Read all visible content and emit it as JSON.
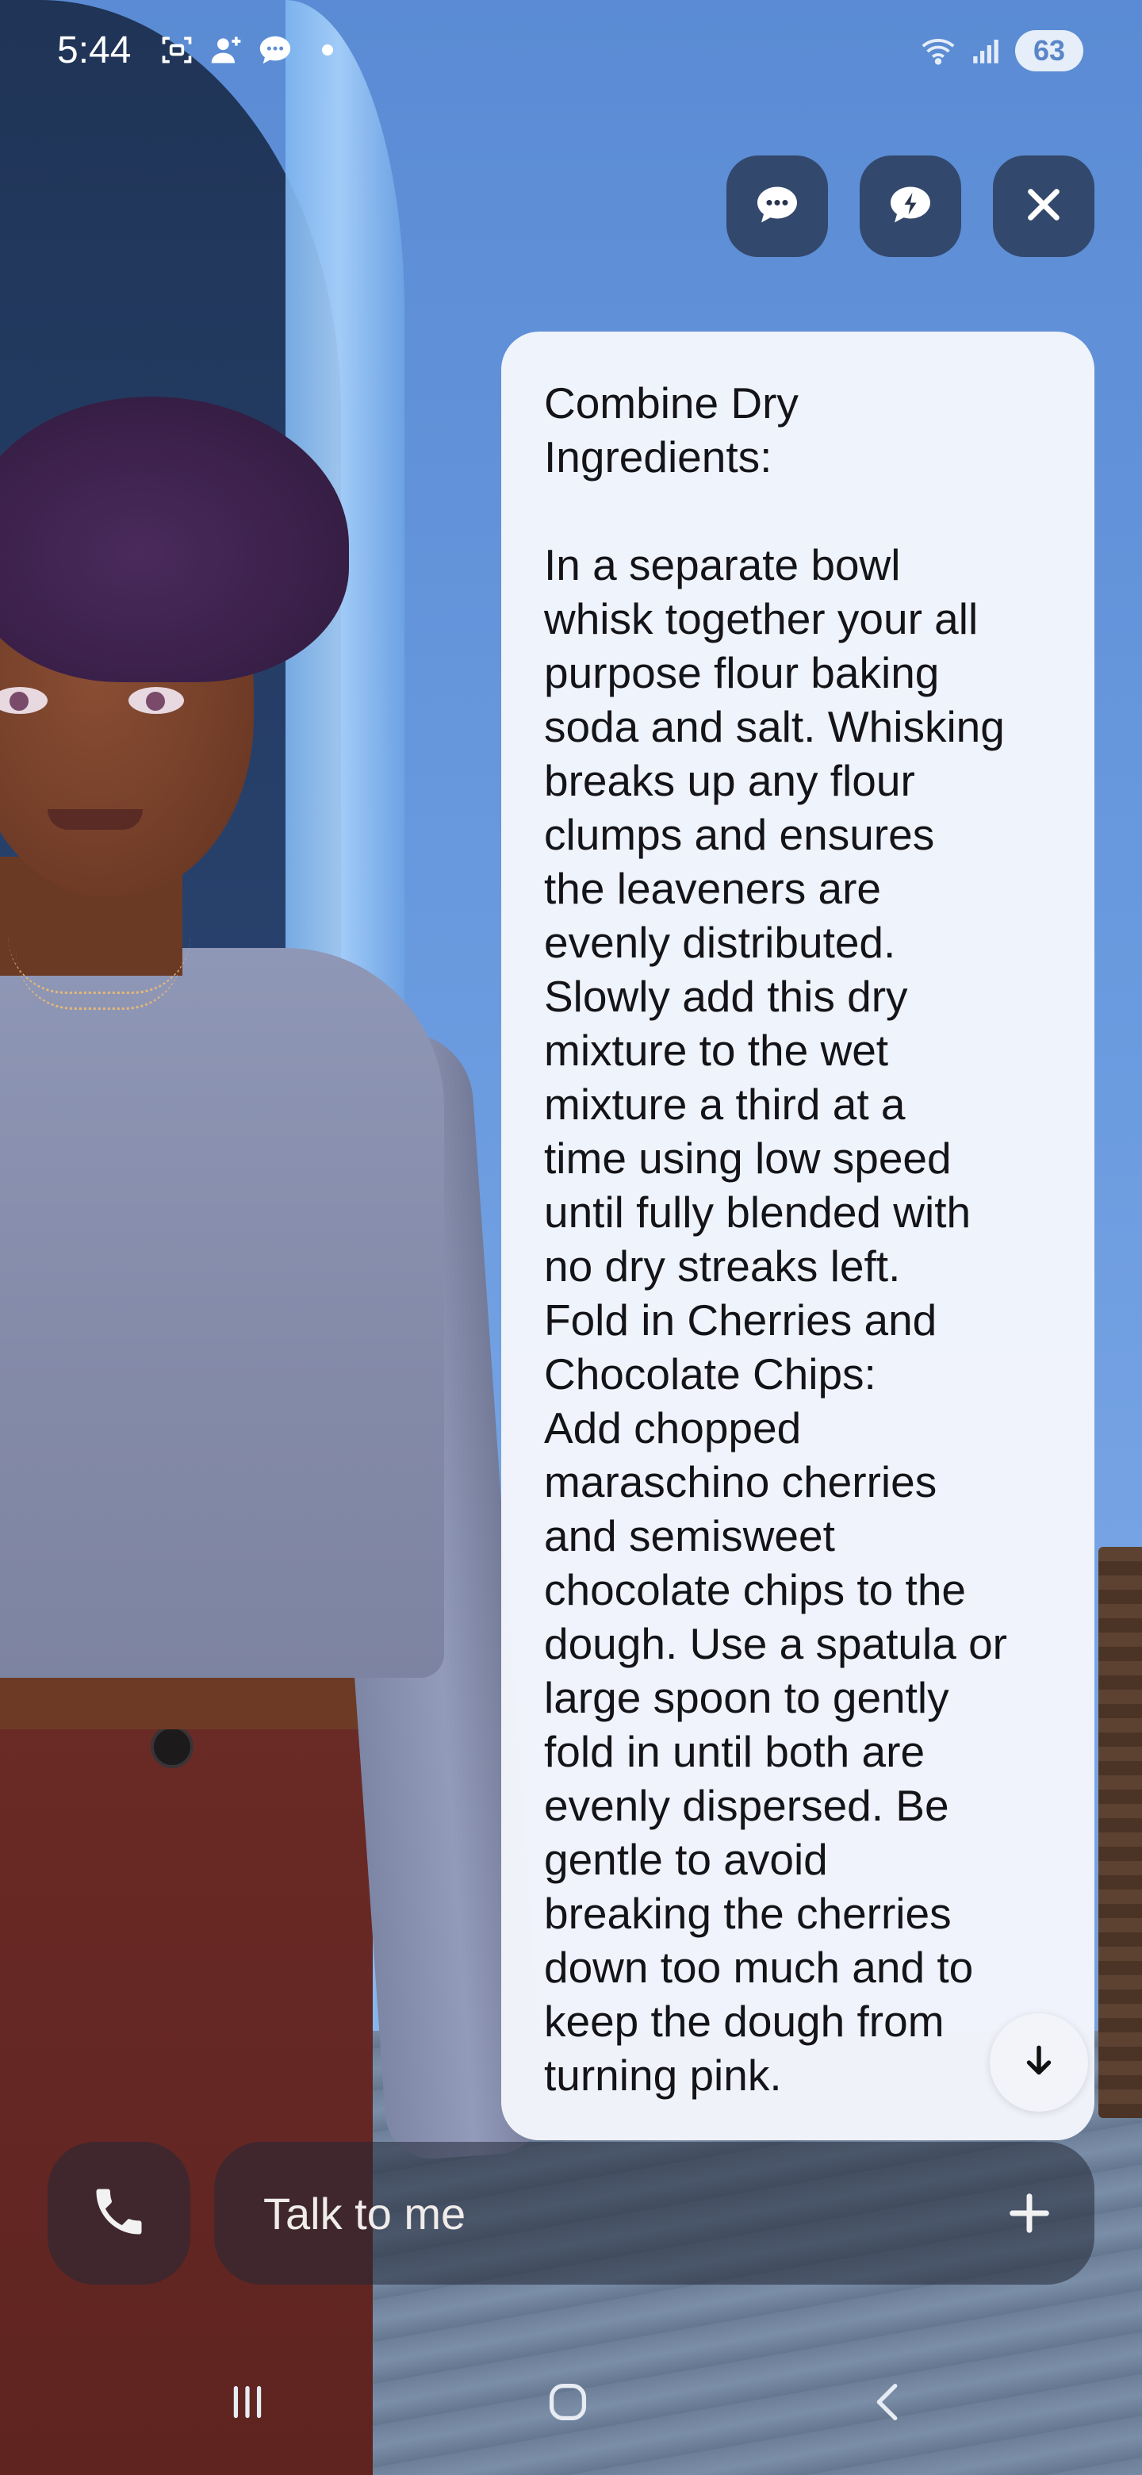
{
  "status_bar": {
    "time": "5:44",
    "battery": "63",
    "left_icons": [
      "screenshot-icon",
      "add-person-icon",
      "chat-bubble-icon",
      "notification-dot"
    ],
    "right_icons": [
      "wifi-icon",
      "signal-icon",
      "battery-icon"
    ]
  },
  "top_actions": {
    "buttons": [
      "chat-icon",
      "quick-reply-icon",
      "close-icon"
    ]
  },
  "message": {
    "text": "Combine Dry\nIngredients:\n\nIn a separate bowl\nwhisk together your all\npurpose flour baking\nsoda and salt. Whisking\nbreaks up any flour\nclumps and ensures\nthe leaveners are\nevenly distributed.\nSlowly add this dry\nmixture to the wet\nmixture a third at a\ntime using low speed\nuntil fully blended with\nno dry streaks left.\nFold in Cherries and\nChocolate Chips:\nAdd chopped\nmaraschino cherries\nand semisweet\nchocolate chips to the\ndough. Use a spatula or\nlarge spoon to gently\nfold in until both are\nevenly dispersed. Be\ngentle to avoid\nbreaking the cherries\ndown too much and to\nkeep the dough from\nturning pink."
  },
  "composer": {
    "placeholder": "Talk to me"
  },
  "nav_bar": {
    "items": [
      "recent-apps-icon",
      "home-icon",
      "back-icon"
    ]
  },
  "colors": {
    "card_background": "#f4f6fc",
    "button_background": "#28344f",
    "input_background": "#232837"
  }
}
